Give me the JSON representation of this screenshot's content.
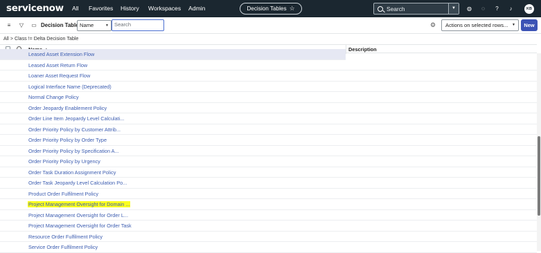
{
  "nav": {
    "logo": "servicenow",
    "links": [
      "All",
      "Favorites",
      "History",
      "Workspaces",
      "Admin"
    ],
    "context_title": "Decision Tables",
    "search_placeholder": "Search",
    "avatar_initials": "KB"
  },
  "toolbar": {
    "title": "Decision Tables",
    "field_selector": "Name",
    "search_placeholder": "Search",
    "actions_label": "Actions on selected rows...",
    "new_label": "New"
  },
  "breadcrumb": "All > Class != Delta Decision Table",
  "table": {
    "columns": [
      "Name",
      "Description"
    ],
    "rows": [
      "Leased Asset Extension Flow",
      "Leased Asset Return Flow",
      "Loaner Asset Request Flow",
      "Logical Interface Name (Deprecated)",
      "Normal Change Policy",
      "Order Jeopardy Enablement Policy",
      "Order Line Item Jeopardy Level Calculati...",
      "Order Priority Policy by Customer Attrib...",
      "Order Priority Policy by Order Type",
      "Order Priority Policy by Specification A...",
      "Order Priority Policy by Urgency",
      "Order Task Duration Assignment Policy",
      "Order Task Jeopardy Level Calculation Po...",
      "Product Order Fulfilment Policy",
      "Project Management Oversight for Domain ...",
      "Project Management Oversight for Order L...",
      "Project Management Oversight for Order Task",
      "Resource Order Fulfilment Policy",
      "Service Order Fulfilment Policy"
    ],
    "highlighted_row": "Project Management Oversight for Domain ...",
    "colors": {
      "link": "#3b5cb0",
      "highlight": "#fbff1f",
      "nav_bg": "#1b2730",
      "new_button": "#3c53b5"
    }
  }
}
